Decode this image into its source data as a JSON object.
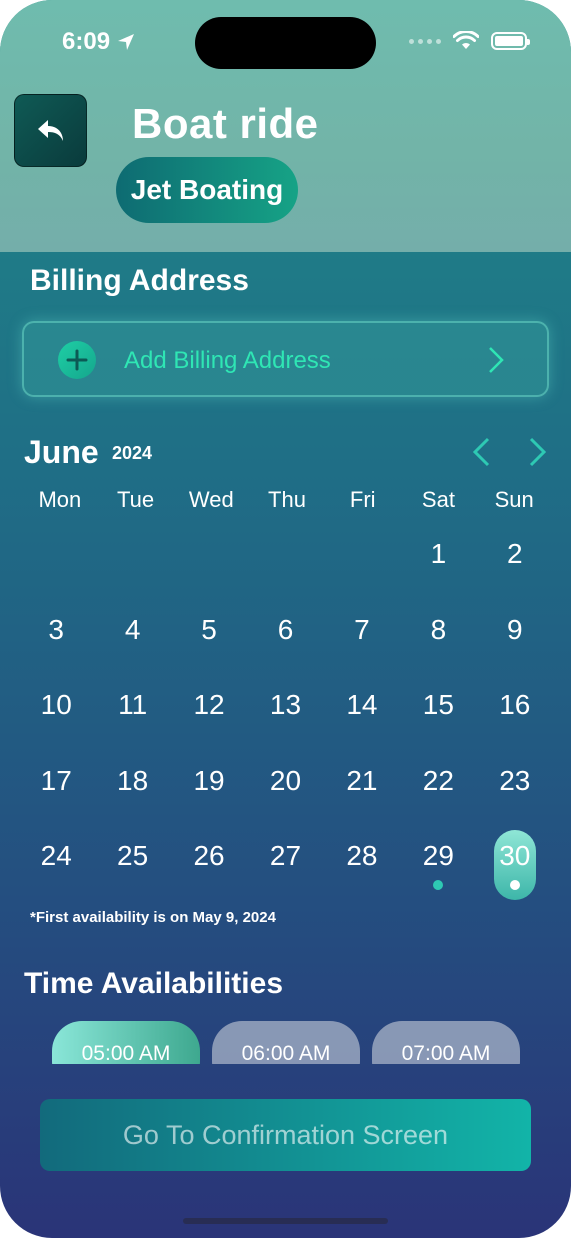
{
  "status": {
    "time": "6:09"
  },
  "header": {
    "title": "Boat ride",
    "chip": "Jet Boating"
  },
  "billing": {
    "section_title": "Billing Address",
    "add_label": "Add Billing Address"
  },
  "calendar": {
    "month": "June",
    "year": "2024",
    "weekdays": [
      "Mon",
      "Tue",
      "Wed",
      "Thu",
      "Fri",
      "Sat",
      "Sun"
    ],
    "days": [
      "1",
      "2",
      "3",
      "4",
      "5",
      "6",
      "7",
      "8",
      "9",
      "10",
      "11",
      "12",
      "13",
      "14",
      "15",
      "16",
      "17",
      "18",
      "19",
      "20",
      "21",
      "22",
      "23",
      "24",
      "25",
      "26",
      "27",
      "28",
      "29",
      "30"
    ],
    "selected": "30",
    "marked": [
      "29",
      "30"
    ],
    "note": "*First availability is on May 9, 2024"
  },
  "time": {
    "section_title": "Time Availabilities",
    "slots": [
      "05:00 AM",
      "06:00 AM",
      "07:00 AM"
    ],
    "selected": "05:00 AM"
  },
  "cta": {
    "label": "Go To Confirmation Screen"
  },
  "colors": {
    "accent": "#2fe6b4",
    "chip": "#16a386"
  }
}
